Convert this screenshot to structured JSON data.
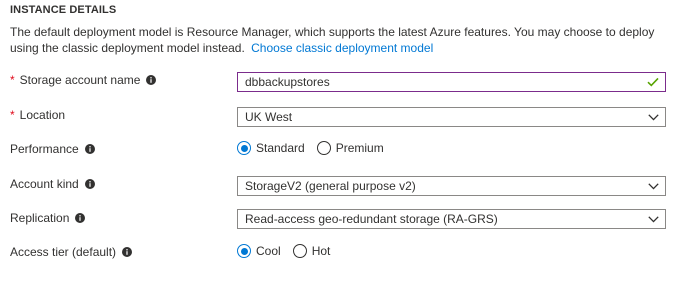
{
  "section": {
    "title": "INSTANCE DETAILS",
    "description": "The default deployment model is Resource Manager, which supports the latest Azure features. You may choose to deploy using the classic deployment model instead.",
    "classic_link": "Choose classic deployment model"
  },
  "storage_account_name": {
    "label": "Storage account name",
    "required": true,
    "value": "dbbackupstores",
    "valid": true,
    "icons": {
      "info": "info-icon",
      "status": "checkmark-icon"
    }
  },
  "location": {
    "label": "Location",
    "required": true,
    "selected": "UK West",
    "icons": {
      "dropdown": "chevron-down-icon"
    }
  },
  "performance": {
    "label": "Performance",
    "options": [
      "Standard",
      "Premium"
    ],
    "selected": "Standard"
  },
  "account_kind": {
    "label": "Account kind",
    "selected": "StorageV2 (general purpose v2)"
  },
  "replication": {
    "label": "Replication",
    "selected": "Read-access geo-redundant storage (RA-GRS)"
  },
  "access_tier": {
    "label": "Access tier (default)",
    "options": [
      "Cool",
      "Hot"
    ],
    "selected": "Cool"
  },
  "colors": {
    "accent_blue": "#0078d4",
    "required_red": "#e00b1c",
    "valid_green": "#57a300",
    "active_border": "#7b2c8c"
  }
}
